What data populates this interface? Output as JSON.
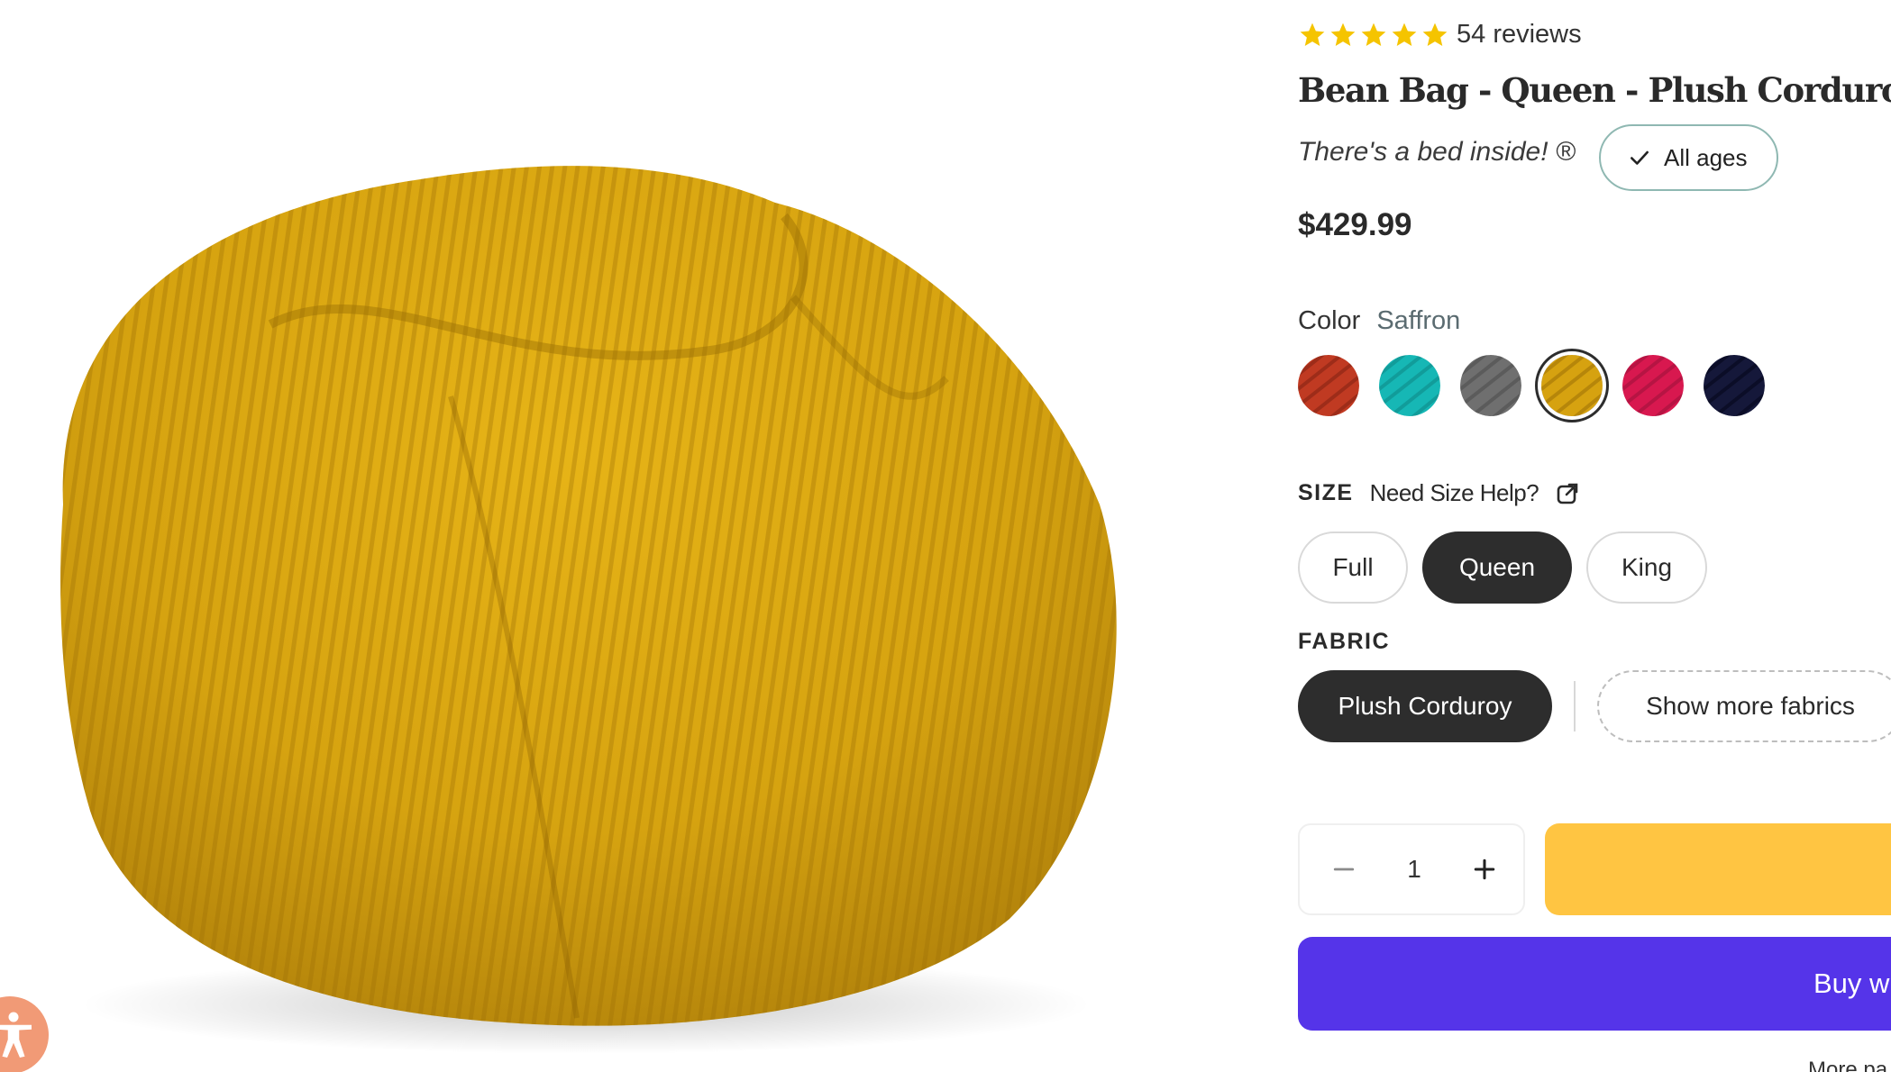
{
  "product": {
    "image_alt": "Saffron plush corduroy bean bag",
    "rating": 5,
    "rating_max": 5,
    "reviews_label": "54 reviews",
    "title": "Bean Bag - Queen - Plush Corduroy",
    "tagline": "There's a bed inside! ®",
    "age_badge": "All ages",
    "price": "$429.99"
  },
  "color": {
    "label": "Color",
    "selected": "Saffron",
    "swatches": [
      {
        "name": "swatch-red",
        "hex": "#c03a22"
      },
      {
        "name": "swatch-teal",
        "hex": "#16b7b5"
      },
      {
        "name": "swatch-gray",
        "hex": "#6f6f6f"
      },
      {
        "name": "swatch-saffron",
        "hex": "#d6a210",
        "selected": true
      },
      {
        "name": "swatch-pink",
        "hex": "#d8184f"
      },
      {
        "name": "swatch-navy",
        "hex": "#15183a"
      }
    ]
  },
  "size": {
    "label": "SIZE",
    "help": "Need Size Help?",
    "options": [
      "Full",
      "Queen",
      "King"
    ],
    "selected": "Queen"
  },
  "fabric": {
    "label": "FABRIC",
    "selected": "Plush Corduroy",
    "more": "Show more fabrics"
  },
  "cart": {
    "quantity": "1",
    "buy_label": "Buy w",
    "more_payment": "More pa"
  },
  "colors": {
    "star": "#f5c400",
    "primary": "#5534e9",
    "cart": "#ffc542",
    "dark_pill": "#2d2d2d",
    "product": "#d9a514",
    "accessibility": "#f19a76"
  }
}
